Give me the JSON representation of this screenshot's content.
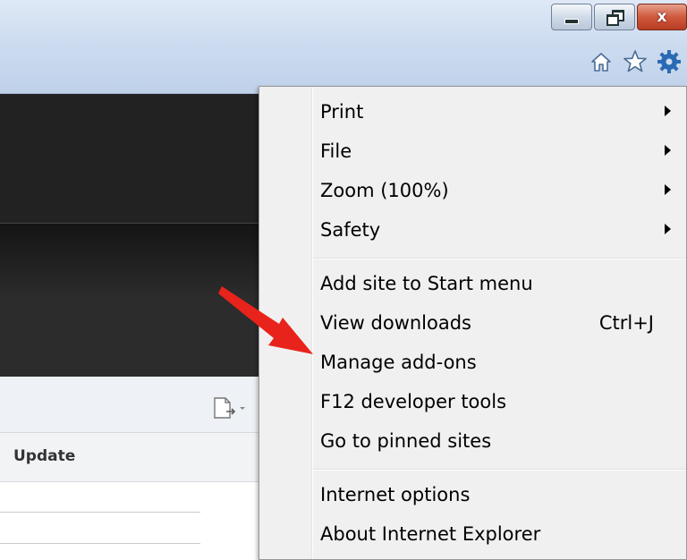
{
  "window": {
    "caption_buttons": [
      {
        "name": "minimize",
        "icon": "minimize-icon"
      },
      {
        "name": "restore",
        "icon": "restore-icon"
      },
      {
        "name": "close",
        "icon": "close-icon",
        "glyph": "x"
      }
    ]
  },
  "toolbar": {
    "icons": [
      "home-icon",
      "favorites-star-icon",
      "tools-gear-icon"
    ],
    "colors": {
      "icon_blue": "#2a6ab4",
      "frame_blue": "#cddcf0"
    }
  },
  "page": {
    "column_header": "Update"
  },
  "menu": {
    "groups": [
      [
        {
          "label": "Print",
          "submenu": true
        },
        {
          "label": "File",
          "submenu": true
        },
        {
          "label": "Zoom (100%)",
          "submenu": true
        },
        {
          "label": "Safety",
          "submenu": true
        }
      ],
      [
        {
          "label": "Add site to Start menu"
        },
        {
          "label": "View downloads",
          "shortcut": "Ctrl+J"
        },
        {
          "label": "Manage add-ons"
        },
        {
          "label": "F12 developer tools"
        },
        {
          "label": "Go to pinned sites"
        }
      ],
      [
        {
          "label": "Internet options"
        },
        {
          "label": "About Internet Explorer"
        }
      ]
    ]
  },
  "annotation": {
    "type": "red-arrow",
    "color": "#e8231b",
    "points_to": "Manage add-ons"
  }
}
